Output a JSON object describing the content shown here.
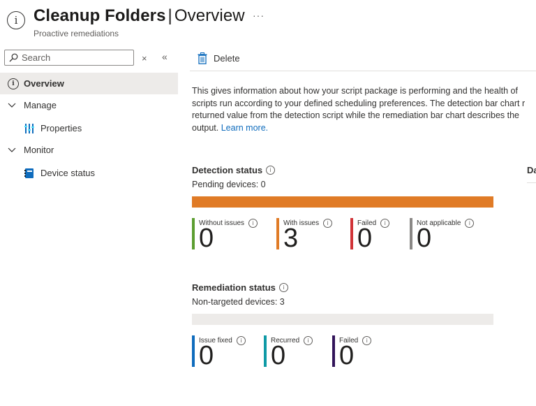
{
  "header": {
    "title": "Cleanup Folders",
    "separator": "|",
    "section": "Overview",
    "subtitle": "Proactive remediations",
    "more_label": "···",
    "icon": "info-circle-icon"
  },
  "sidebar": {
    "search": {
      "placeholder": "Search",
      "value": ""
    },
    "clear_label": "×",
    "collapse_label": "«",
    "items": [
      {
        "label": "Overview",
        "icon": "info-circle-icon",
        "active": true
      },
      {
        "label": "Manage",
        "icon": "chevron-down-icon",
        "group": true
      },
      {
        "label": "Properties",
        "icon": "properties-bars-icon"
      },
      {
        "label": "Monitor",
        "icon": "chevron-down-icon",
        "group": true
      },
      {
        "label": "Device status",
        "icon": "device-status-icon"
      }
    ]
  },
  "toolbar": {
    "delete_label": "Delete",
    "delete_icon": "trash-icon"
  },
  "description": {
    "lines": [
      "This gives information about how your script package is performing and the health of",
      "scripts run according to your defined scheduling preferences. The detection bar chart r",
      "returned value from the detection script while the remediation bar chart describes the",
      "output."
    ],
    "link_text": "Learn more."
  },
  "detection": {
    "title": "Detection status",
    "subtitle": "Pending devices: 0",
    "bar_color": "#e07b26",
    "stats": [
      {
        "label": "Without issues",
        "value": "0",
        "color": "#5c9e31"
      },
      {
        "label": "With issues",
        "value": "3",
        "color": "#e07b26"
      },
      {
        "label": "Failed",
        "value": "0",
        "color": "#d13438"
      },
      {
        "label": "Not applicable",
        "value": "0",
        "color": "#8a8886"
      }
    ]
  },
  "remediation": {
    "title": "Remediation status",
    "subtitle": "Non-targeted devices: 3",
    "bar_color": "#edebe9",
    "stats": [
      {
        "label": "Issue fixed",
        "value": "0",
        "color": "#0f6cbd"
      },
      {
        "label": "Recurred",
        "value": "0",
        "color": "#0f9aa6"
      },
      {
        "label": "Failed",
        "value": "0",
        "color": "#32145a"
      }
    ]
  },
  "right_panel": {
    "tab_fragment": "Da"
  },
  "colors": {
    "accent": "#0f6cbd",
    "nav_active_bg": "#edebe9"
  }
}
